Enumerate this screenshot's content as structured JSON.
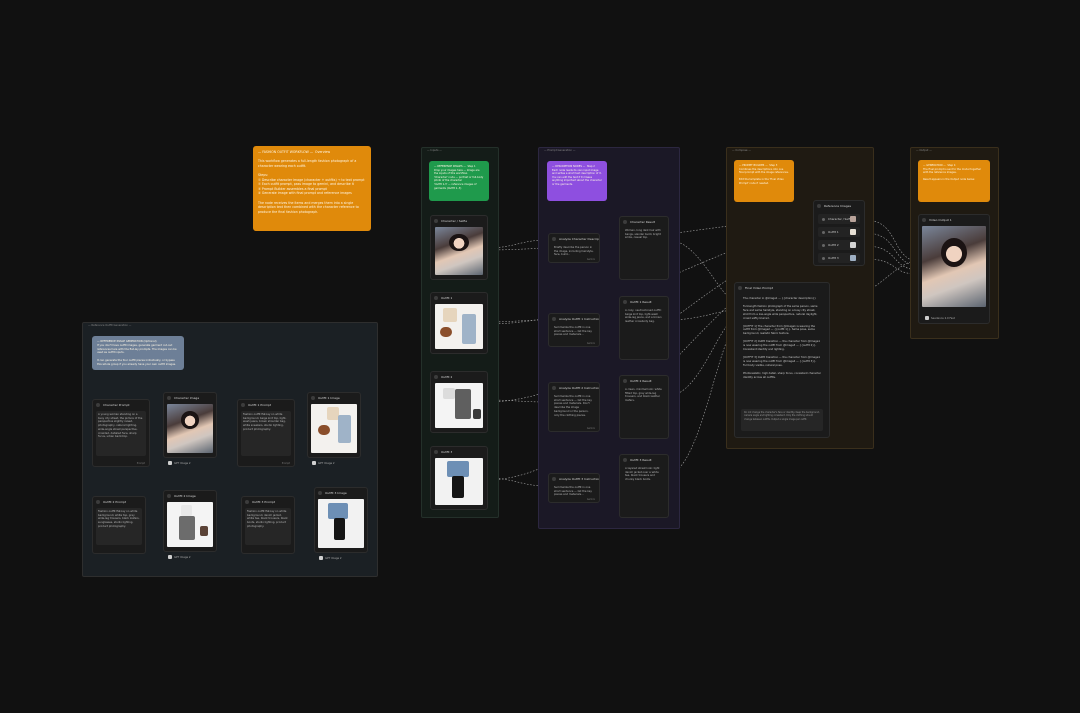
{
  "groups": {
    "left": "— Reference Outfit Generation —",
    "inputs": "— Inputs —",
    "prompts": "— Prompt Generation —",
    "compose": "— Compose —",
    "output": "— Output —"
  },
  "notes": {
    "intro": "— FASHION OUTFIT WORKFLOW —  Overview\n\nThis workflow generates a full-length fashion photograph of a character wearing each outfit.\n\nSteps:\n① Describe character image (character + outfits) → to text prompt\n② Each outfit prompt, pass image to gemini, and describe it\n③ Prompt Builder assembles a final prompt\n④ Generate image with final prompt and reference images\n\nThe node receives the items and merges them into a single description text then combined with the character reference to produce the final fashion photograph.",
    "left": "— REFERENCE IMAGE GENERATION (Optional)\nIf you don't have outfit images, generate garment cut-out references here with the flat-lay prompts. The images can be used as outfit inputs.\n\nIt can generate the four outfit pieces individually, or bypass this whole group if you already have your own outfit images.",
    "inputs": "— REFERENCE IMAGES —  Step 1\nDrop your images here — Image are the inputs of this workflow.\n'Character' node — portrait or full-body photo of the character\n'Outfit 1-3' — reference images of garments (Outfit 1..3)",
    "prompts": "— DESCRIPTION NODES —  Step 2\nEach node reads its own input image and writes a short text description of it. You can edit the text if it misses anything important about the character or the garments.",
    "compose": "— PROMPT BUILDER —  Step 3\nCombines the descriptions into one final prompt with the image references.\n\nEdit the template in the 'Final Video Prompt' node if needed.",
    "output": "— GENERATION —  Step 4\nThe final prompt is sent to the model together with the reference images.\n\nResult appears in the Output node below."
  },
  "left_nodes": {
    "char_prompt": {
      "title": "Character Prompt",
      "text": "A young woman standing on a busy city street, the picture of the perspective slightly raised, photography, natural lighting, wide-angle street perspective, crowded, detailed face, sharp focus, urban backdrop.",
      "foot": "Prompt"
    },
    "char_image": {
      "title": "Character Image",
      "label": "GPT Image 2"
    },
    "outfit1_prompt": {
      "title": "Outfit 1 Prompt",
      "text": "Fashion outfit flat-lay on white background, beige knit top, light-wash jeans, brown shoulder bag, white sneakers, studio lighting, product photography.",
      "foot": "Prompt"
    },
    "outfit1_image": {
      "title": "Outfit 1 Image",
      "label": "GPT Image 2"
    },
    "outfit2_prompt": {
      "title": "Outfit 2 Prompt",
      "text": "Fashion outfit flat-lay on white background, white top, grey wide-leg trousers, black loafers, sunglasses, studio lighting, product photography.",
      "foot": "Prompt"
    },
    "outfit2_image": {
      "title": "Outfit 2 Image",
      "label": "GPT Image 2"
    },
    "outfit3_prompt": {
      "title": "Outfit 3 Prompt",
      "text": "Fashion outfit flat-lay on white background, denim jacket, white tee, black trousers, black boots, studio lighting, product photography.",
      "foot": "Prompt"
    },
    "outfit3_image": {
      "title": "Outfit 3 Image",
      "label": "GPT Image 2"
    }
  },
  "input_nodes": [
    {
      "title": "Character / Selfie"
    },
    {
      "title": "Outfit 1"
    },
    {
      "title": "Outfit 2"
    },
    {
      "title": "Outfit 3"
    }
  ],
  "describe_nodes": [
    {
      "title": "Analyze Character Description",
      "text": "Briefly describe the person in the image, including hairstyle, face, build...",
      "foot": "Gemini"
    },
    {
      "title": "Analyze Outfit 1 Instruction",
      "text": "Summarize the outfit in one short sentence — list the key pieces and materials...",
      "foot": "Gemini"
    },
    {
      "title": "Analyze Outfit 2 Instruction",
      "text": "Summarize the outfit in one short sentence — list the key pieces and materials. Don't describe the image background or the person, only the clothing pieces.",
      "foot": "Gemini"
    },
    {
      "title": "Analyze Outfit 3 Instruction",
      "text": "Summarize the outfit in one short sentence — list the key pieces and materials...",
      "foot": "Gemini"
    }
  ],
  "result_nodes": [
    {
      "title": "Character Result",
      "text": "Woman, long dark hair with bangs, slender build, bright smile, casual top."
    },
    {
      "title": "Outfit 1 Result",
      "text": "A cozy, neutral-toned outfit: beige knit top, light-wash wide-leg jeans, and a brown leather crossbody bag."
    },
    {
      "title": "Outfit 2 Result",
      "text": "A clean, minimal look: white fitted top, grey wide-leg trousers, and black leather loafers."
    },
    {
      "title": "Outfit 3 Result",
      "text": "A layered street look: light denim jacket over a white tee, black trousers and chunky black boots."
    }
  ],
  "reference_list": {
    "title": "Reference Images",
    "rows": [
      "Character / Selfie",
      "Outfit 1",
      "Outfit 2",
      "Outfit 3"
    ]
  },
  "final_prompt": {
    "title": "Final Video Prompt",
    "lines": [
      "The character in @Image1 — {{character description}}",
      "Full-length fashion photograph of the same person, same face and same hairstyle, standing on a busy city street, shot from a low-angle wide perspective, natural daylight, crowd softly blurred.",
      "[OUTFIT 1] The character from @Image1 is wearing the outfit from @Image2 — {{outfit 1}}. Same pose, same background, realistic fabric texture.",
      "[OUTFIT 2] Outfit transition — the character from @Image1 is now wearing the outfit from @Image3 — {{outfit 2}}. Consistent identity and lighting.",
      "[OUTFIT 3] Outfit transition — the character from @Image1 is now wearing the outfit from @Image4 — {{outfit 3}}. Full body visible, natural pose.",
      "Photorealistic, high detail, sharp focus, consistent character identity across all outfits."
    ],
    "footer": "Do not change the character's face or identity. Keep the background, camera angle and lighting consistent. Only the clothing should change between outfits. Output a single image per outfit."
  },
  "output_node": {
    "title": "Video Output 1",
    "label": "Seedance 2.0 Fast"
  }
}
